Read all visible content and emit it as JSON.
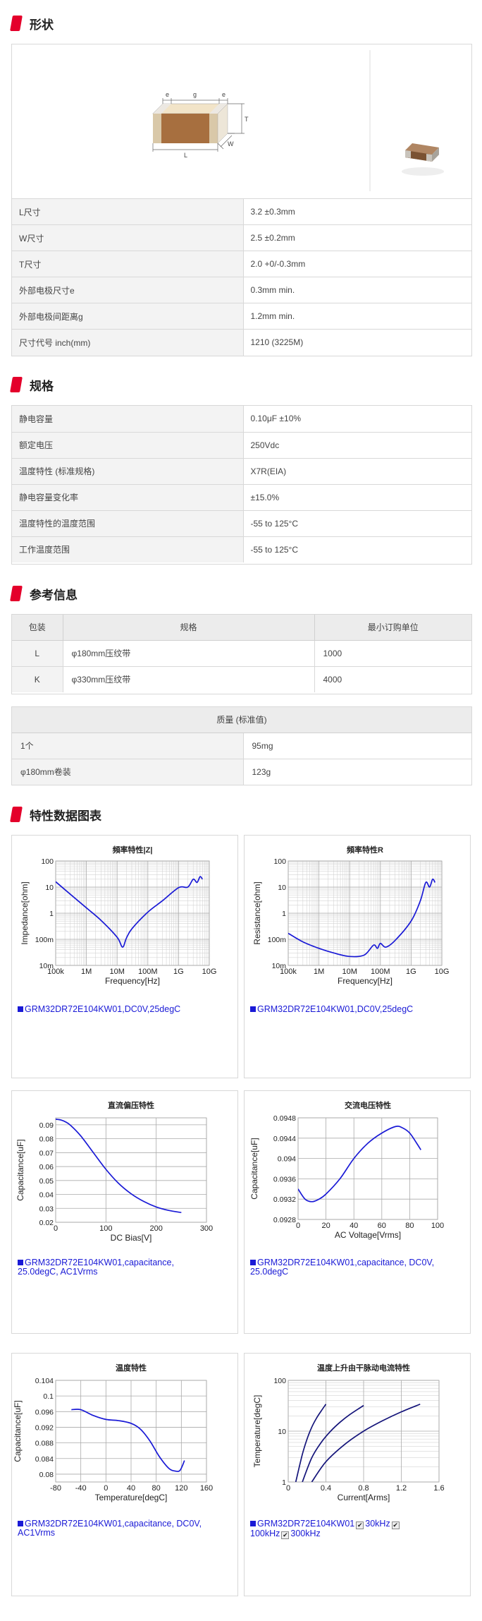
{
  "sections": {
    "shape": "形状",
    "spec": "规格",
    "ref": "参考信息",
    "charts": "特性数据图表"
  },
  "diagram_labels": {
    "e1": "e",
    "g": "g",
    "e2": "e",
    "T": "T",
    "L": "L",
    "W": "W"
  },
  "shape_rows": [
    {
      "k": "L尺寸",
      "v": "3.2 ±0.3mm"
    },
    {
      "k": "W尺寸",
      "v": "2.5 ±0.2mm"
    },
    {
      "k": "T尺寸",
      "v": "2.0 +0/-0.3mm"
    },
    {
      "k": "外部电极尺寸e",
      "v": "0.3mm min."
    },
    {
      "k": "外部电极间距离g",
      "v": "1.2mm min."
    },
    {
      "k": "尺寸代号 inch(mm)",
      "v": "1210 (3225M)"
    }
  ],
  "spec_rows": [
    {
      "k": "静电容量",
      "v": "0.10μF ±10%"
    },
    {
      "k": "额定电压",
      "v": "250Vdc"
    },
    {
      "k": "温度特性 (标准规格)",
      "v": "X7R(EIA)"
    },
    {
      "k": "静电容量变化率",
      "v": "±15.0%"
    },
    {
      "k": "温度特性的温度范围",
      "v": "-55 to 125°C"
    },
    {
      "k": "工作温度范围",
      "v": "-55 to 125°C"
    }
  ],
  "pack_table": {
    "headers": [
      "包装",
      "规格",
      "最小订购单位"
    ],
    "rows": [
      [
        "L",
        "φ180mm压纹带",
        "1000"
      ],
      [
        "K",
        "φ330mm压纹带",
        "4000"
      ]
    ]
  },
  "mass_table": {
    "header": "质量 (标准值)",
    "rows": [
      [
        "1个",
        "95mg"
      ],
      [
        "φ180mm卷装",
        "123g"
      ]
    ]
  },
  "chart_data": [
    {
      "type": "line",
      "title": "頻率特性|Z|",
      "xlabel": "Frequency[Hz]",
      "ylabel": "Impedance[ohm]",
      "x_scale": "log",
      "y_scale": "log",
      "x_ticks": [
        "100k",
        "1M",
        "10M",
        "100M",
        "1G",
        "10G"
      ],
      "y_ticks": [
        "10m",
        "100m",
        "1",
        "10",
        "100"
      ],
      "xlim": [
        100000,
        10000000000
      ],
      "ylim": [
        0.01,
        100
      ],
      "series": [
        {
          "name": "GRM32DR72E104KW01,DC0V,25degC",
          "x": [
            100000,
            300000,
            1000000,
            3000000,
            10000000,
            15000000,
            20000000,
            30000000,
            100000000,
            300000000,
            1000000000,
            2000000000,
            3000000000,
            4000000000,
            5000000000,
            6000000000
          ],
          "y": [
            16,
            5.3,
            1.6,
            0.53,
            0.12,
            0.05,
            0.11,
            0.25,
            1.1,
            3.0,
            9.5,
            10,
            20,
            15,
            25,
            20
          ]
        }
      ],
      "legend": "GRM32DR72E104KW01,DC0V,25degC"
    },
    {
      "type": "line",
      "title": "頻率特性R",
      "xlabel": "Frequency[Hz]",
      "ylabel": "Resistance[ohm]",
      "x_scale": "log",
      "y_scale": "log",
      "x_ticks": [
        "100k",
        "1M",
        "10M",
        "100M",
        "1G",
        "10G"
      ],
      "y_ticks": [
        "10m",
        "100m",
        "1",
        "10",
        "100"
      ],
      "xlim": [
        100000,
        10000000000
      ],
      "ylim": [
        0.01,
        100
      ],
      "series": [
        {
          "name": "GRM32DR72E104KW01,DC0V,25degC",
          "x": [
            100000,
            300000,
            1000000,
            3000000,
            10000000,
            30000000,
            60000000,
            80000000,
            100000000,
            150000000,
            300000000,
            1000000000,
            2000000000,
            3000000000,
            4000000000,
            5000000000,
            6000000000
          ],
          "y": [
            0.17,
            0.08,
            0.045,
            0.03,
            0.022,
            0.025,
            0.06,
            0.045,
            0.07,
            0.05,
            0.09,
            0.5,
            3,
            15,
            10,
            20,
            15
          ]
        }
      ],
      "legend": "GRM32DR72E104KW01,DC0V,25degC"
    },
    {
      "type": "line",
      "title": "直流偏压特性",
      "xlabel": "DC Bias[V]",
      "ylabel": "Capacitance[uF]",
      "xlim": [
        0,
        300
      ],
      "ylim": [
        0.02,
        0.095
      ],
      "x_ticks": [
        "0",
        "100",
        "200",
        "300"
      ],
      "y_ticks": [
        "0.02",
        "0.03",
        "0.04",
        "0.05",
        "0.06",
        "0.07",
        "0.08",
        "0.09"
      ],
      "series": [
        {
          "name": "GRM32DR72E104KW01,capacitance, 25.0degC, AC1Vrms",
          "x": [
            0,
            10,
            20,
            30,
            50,
            75,
            100,
            125,
            150,
            175,
            200,
            225,
            250
          ],
          "y": [
            0.094,
            0.0935,
            0.092,
            0.0895,
            0.082,
            0.07,
            0.058,
            0.048,
            0.0405,
            0.035,
            0.031,
            0.0285,
            0.027
          ]
        }
      ],
      "legend": "GRM32DR72E104KW01,capacitance, 25.0degC, AC1Vrms"
    },
    {
      "type": "line",
      "title": "交流电压特性",
      "xlabel": "AC Voltage[Vrms]",
      "ylabel": "Capacitance[uF]",
      "xlim": [
        0,
        100
      ],
      "ylim": [
        0.0928,
        0.0948
      ],
      "x_ticks": [
        "0",
        "20",
        "40",
        "60",
        "80",
        "100"
      ],
      "y_ticks": [
        "0.0928",
        "0.0932",
        "0.0936",
        "0.094",
        "0.0944",
        "0.0948"
      ],
      "series": [
        {
          "name": "GRM32DR72E104KW01,capacitance, DC0V, 25.0degC",
          "x": [
            0,
            5,
            10,
            15,
            20,
            30,
            40,
            50,
            60,
            70,
            75,
            80,
            85,
            88
          ],
          "y": [
            0.0934,
            0.0932,
            0.09315,
            0.0932,
            0.0933,
            0.0936,
            0.094,
            0.0943,
            0.0945,
            0.09463,
            0.0946,
            0.0945,
            0.0943,
            0.09417
          ]
        }
      ],
      "legend": "GRM32DR72E104KW01,capacitance, DC0V, 25.0degC"
    },
    {
      "type": "line",
      "title": "温度特性",
      "xlabel": "Temperature[degC]",
      "ylabel": "Capacitance[uF]",
      "xlim": [
        -80,
        160
      ],
      "ylim": [
        0.078,
        0.104
      ],
      "x_ticks": [
        "-80",
        "-40",
        "0",
        "40",
        "80",
        "120",
        "160"
      ],
      "y_ticks": [
        "0.08",
        "0.084",
        "0.088",
        "0.092",
        "0.096",
        "0.1",
        "0.104"
      ],
      "series": [
        {
          "name": "GRM32DR72E104KW01,capacitance, DC0V, AC1Vrms",
          "x": [
            -55,
            -40,
            -20,
            0,
            20,
            40,
            55,
            70,
            85,
            100,
            110,
            118,
            125
          ],
          "y": [
            0.0965,
            0.0965,
            0.095,
            0.094,
            0.0937,
            0.093,
            0.0915,
            0.0885,
            0.0845,
            0.0815,
            0.0808,
            0.081,
            0.0835
          ]
        }
      ],
      "legend": "GRM32DR72E104KW01,capacitance, DC0V, AC1Vrms"
    },
    {
      "type": "line",
      "title": "温度上升由干脉动电流特性",
      "xlabel": "Current[Arms]",
      "ylabel": "Temperature[degC]",
      "y_scale": "log",
      "xlim": [
        0,
        1.6
      ],
      "ylim": [
        1,
        100
      ],
      "x_ticks": [
        "0",
        "0.4",
        "0.8",
        "1.2",
        "1.6"
      ],
      "y_ticks": [
        "1",
        "10",
        "100"
      ],
      "series": [
        {
          "name": "30kHz",
          "x": [
            0.08,
            0.15,
            0.2,
            0.25,
            0.3,
            0.35,
            0.4
          ],
          "y": [
            1,
            3.5,
            7,
            12,
            18,
            25,
            34
          ]
        },
        {
          "name": "100kHz",
          "x": [
            0.15,
            0.25,
            0.35,
            0.45,
            0.55,
            0.65,
            0.8
          ],
          "y": [
            1,
            3,
            6,
            10,
            15,
            21,
            32
          ]
        },
        {
          "name": "300kHz",
          "x": [
            0.25,
            0.4,
            0.6,
            0.8,
            1.0,
            1.2,
            1.4
          ],
          "y": [
            1,
            2.5,
            5.5,
            10,
            16,
            24,
            34
          ]
        }
      ],
      "legend": "GRM32DR72E104KW01",
      "legend_items": [
        "30kHz",
        "100kHz",
        "300kHz"
      ]
    }
  ]
}
